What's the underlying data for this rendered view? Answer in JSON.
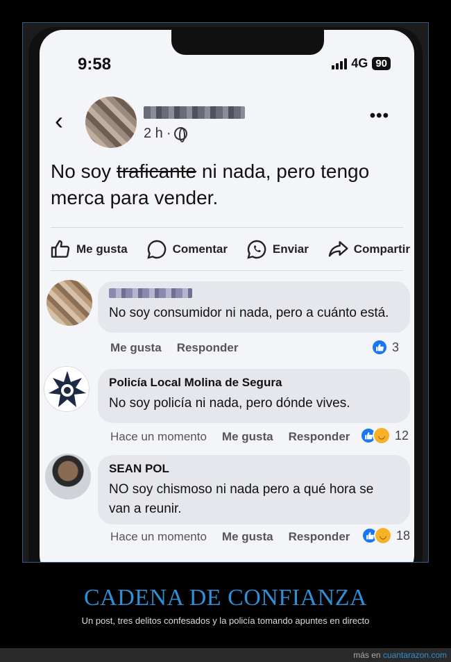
{
  "status": {
    "time": "9:58",
    "network": "4G",
    "battery": "90"
  },
  "post": {
    "time": "2 h",
    "dot": "·",
    "text_before": "No soy ",
    "text_strike": "traficante",
    "text_after": " ni nada, pero tengo merca para vender."
  },
  "actions": [
    {
      "label": "Me gusta"
    },
    {
      "label": "Comentar"
    },
    {
      "label": "Enviar"
    },
    {
      "label": "Compartir"
    }
  ],
  "comments": [
    {
      "text": "No soy consumidor ni nada, pero a cuánto está.",
      "actions": [
        "Me gusta",
        "Responder"
      ],
      "reaction_count": "3"
    },
    {
      "name": "Policía Local Molina de Segura",
      "text": "No soy policía ni nada, pero dónde vives.",
      "time": "Hace un momento",
      "actions": [
        "Me gusta",
        "Responder"
      ],
      "reaction_count": "12"
    },
    {
      "name": "SEAN POL",
      "text": "NO soy chismoso ni nada pero a qué hora se van a reunir.",
      "time": "Hace un momento",
      "actions": [
        "Me gusta",
        "Responder"
      ],
      "reaction_count": "18"
    }
  ],
  "caption": {
    "title": "CADENA DE CONFIANZA",
    "subtitle": "Un post, tres delitos confesados y la policía tomando apuntes en directo"
  },
  "footer": {
    "prefix": "más en ",
    "site": "cuantarazon.com"
  },
  "colors": {
    "accent": "#1877f2",
    "caption": "#2f8fd6"
  }
}
